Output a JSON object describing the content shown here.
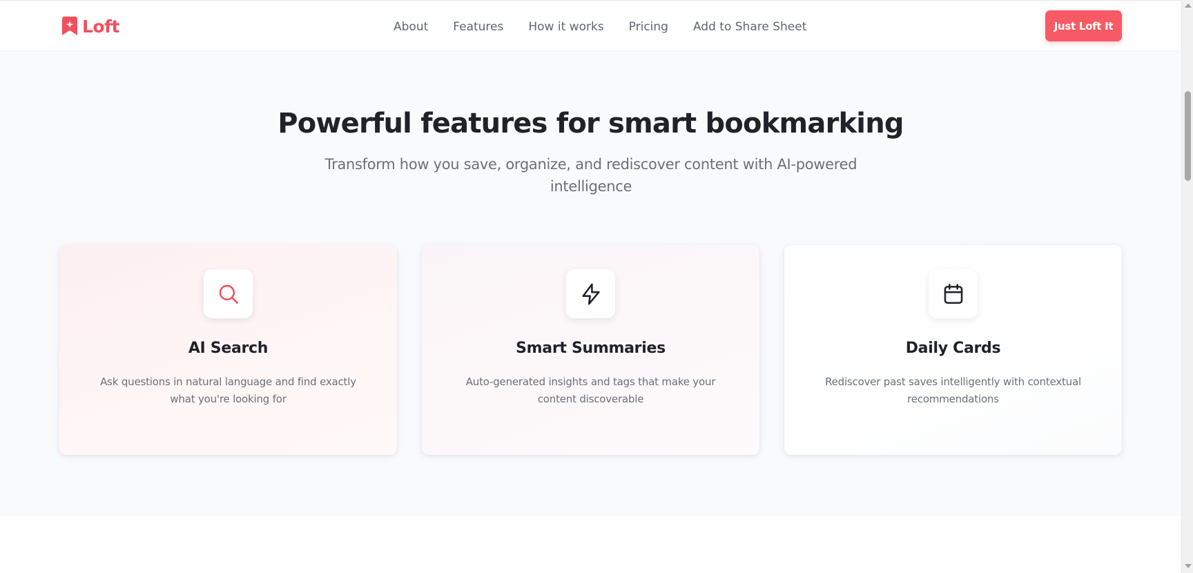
{
  "brand": {
    "name": "Loft",
    "accent": "#f75a64"
  },
  "nav": {
    "items": [
      {
        "label": "About"
      },
      {
        "label": "Features"
      },
      {
        "label": "How it works"
      },
      {
        "label": "Pricing"
      },
      {
        "label": "Add to Share Sheet"
      }
    ],
    "cta_label": "Just Loft It"
  },
  "features": {
    "title": "Powerful features for smart bookmarking",
    "subtitle": "Transform how you save, organize, and rediscover content with AI-powered intelligence",
    "cards": [
      {
        "icon": "search-icon",
        "title": "AI Search",
        "description": "Ask questions in natural language and find exactly what you're looking for"
      },
      {
        "icon": "lightning-icon",
        "title": "Smart Summaries",
        "description": "Auto-generated insights and tags that make your content discoverable"
      },
      {
        "icon": "calendar-icon",
        "title": "Daily Cards",
        "description": "Rediscover past saves intelligently with contextual recommendations"
      }
    ]
  }
}
